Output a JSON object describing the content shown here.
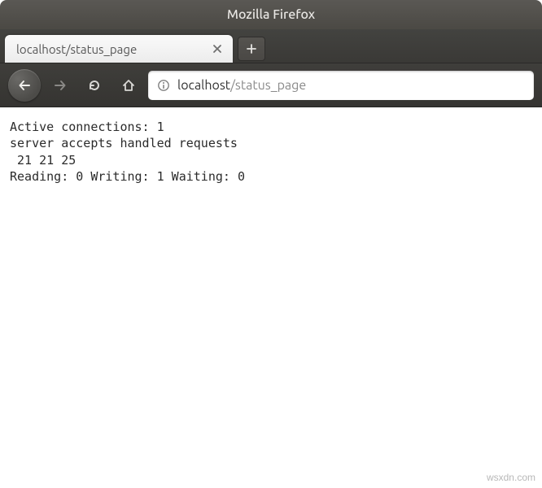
{
  "window": {
    "title": "Mozilla Firefox"
  },
  "tabs": {
    "active": {
      "label": "localhost/status_page"
    }
  },
  "urlbar": {
    "host": "localhost",
    "path": "/status_page"
  },
  "page": {
    "line1": "Active connections: 1",
    "line2": "server accepts handled requests",
    "line3": " 21 21 25",
    "line4": "Reading: 0 Writing: 1 Waiting: 0"
  },
  "watermark": "wsxdn.com",
  "nginx_status": {
    "active_connections": 1,
    "accepts": 21,
    "handled": 21,
    "requests": 25,
    "reading": 0,
    "writing": 1,
    "waiting": 0
  }
}
